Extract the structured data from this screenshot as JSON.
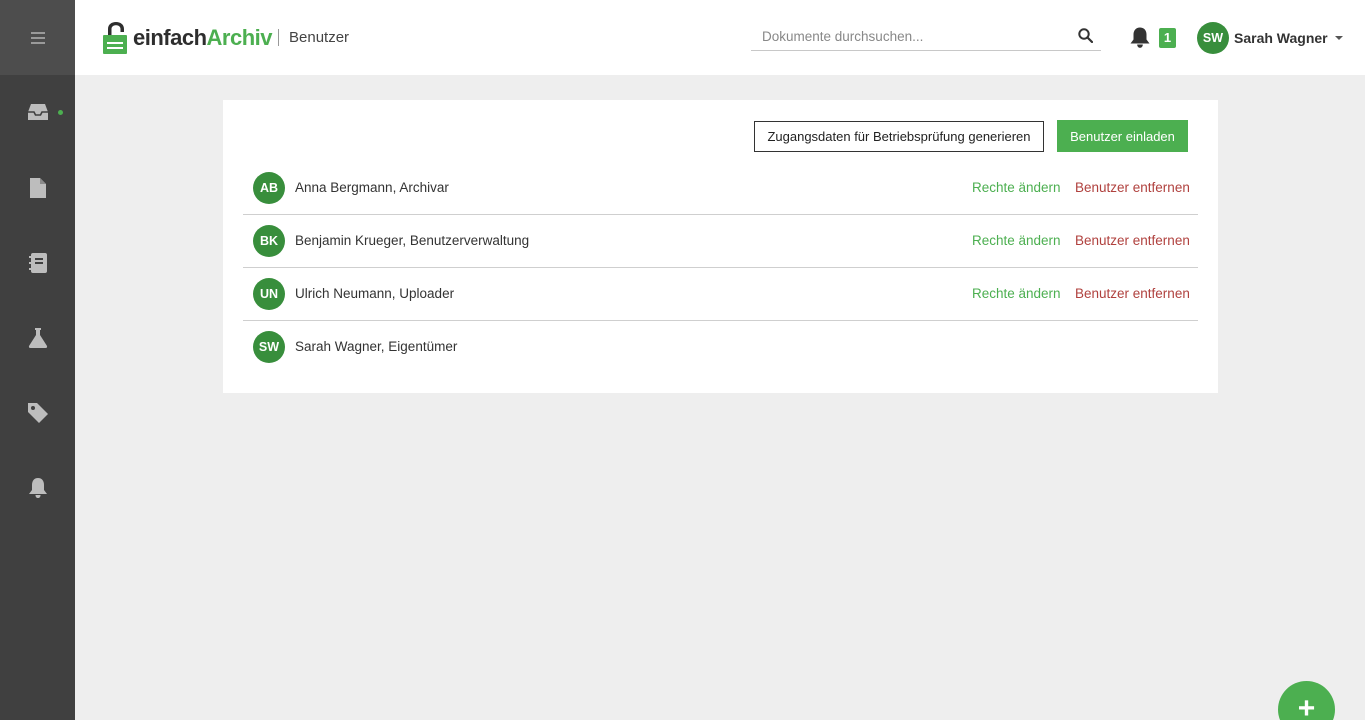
{
  "app": {
    "logo_part1": "einfach",
    "logo_part2": "Archiv",
    "page_title": "Benutzer",
    "brand_color": "#4caf50"
  },
  "sidebar": {
    "items": [
      {
        "icon": "menu-icon"
      },
      {
        "icon": "inbox-icon"
      },
      {
        "icon": "document-icon"
      },
      {
        "icon": "notebook-icon"
      },
      {
        "icon": "flask-icon"
      },
      {
        "icon": "tag-icon"
      },
      {
        "icon": "bell-icon"
      }
    ]
  },
  "header": {
    "search_placeholder": "Dokumente durchsuchen...",
    "notification_count": "1",
    "user_initials": "SW",
    "user_name": "Sarah Wagner"
  },
  "toolbar": {
    "audit_button": "Zugangsdaten für Betriebsprüfung generieren",
    "invite_button": "Benutzer einladen"
  },
  "users": [
    {
      "initials": "AB",
      "label": "Anna Bergmann, Archivar",
      "rights": "Rechte ändern",
      "remove": "Benutzer entfernen"
    },
    {
      "initials": "BK",
      "label": "Benjamin Krueger, Benutzerverwaltung",
      "rights": "Rechte ändern",
      "remove": "Benutzer entfernen"
    },
    {
      "initials": "UN",
      "label": "Ulrich Neumann, Uploader",
      "rights": "Rechte ändern",
      "remove": "Benutzer entfernen"
    },
    {
      "initials": "SW",
      "label": "Sarah Wagner, Eigentümer"
    }
  ],
  "fab": {
    "label": "+"
  }
}
